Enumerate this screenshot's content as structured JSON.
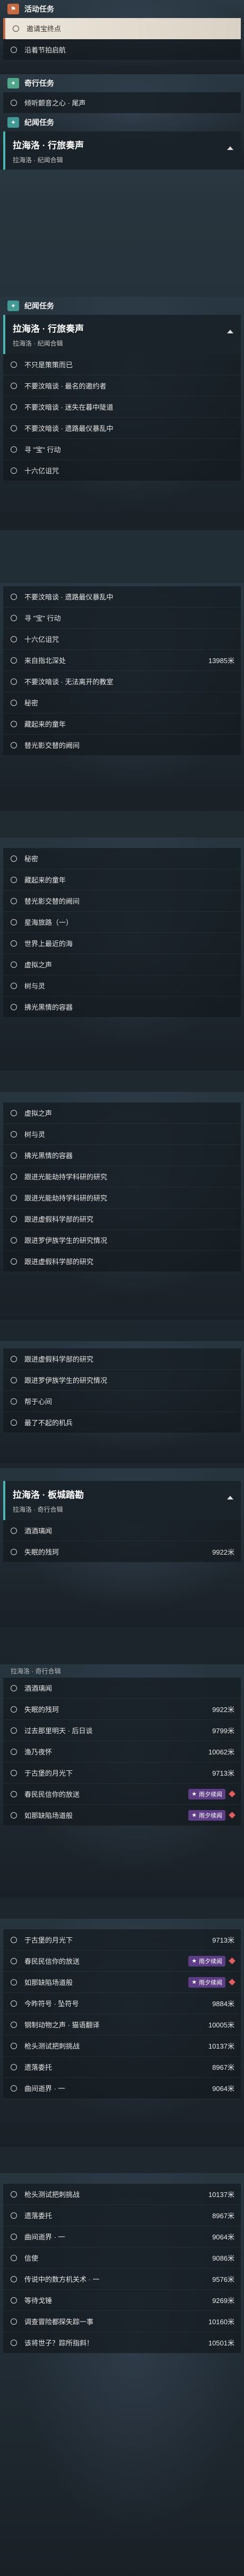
{
  "sections": {
    "event": "活动任务",
    "fortune": "奇行任务",
    "chronicle": "纪闻任务"
  },
  "event_tasks": [
    "邀请宝终点",
    "沿着节拍启航"
  ],
  "fortune_tasks": [
    "倾听颤音之心 · 尾声"
  ],
  "quest": {
    "title": "拉海洛 · 行旅奏声",
    "title_alt": "拉海洛 · 板城踏勘",
    "subtitle": "拉海洛 · 纪闻合辑",
    "subtitle_alt": "拉海洛 · 奇行合辑"
  },
  "list_a": [
    "不只是策策而已",
    "不要汶暗谈 · 最名的邀约者",
    "不要汶暗谈 · 迷失在暮中陡道",
    "不要汶暗谈 · 遗路最仪暴乱中",
    "寻 \"宝\" 行动",
    "十六亿诅咒"
  ],
  "list_b": [
    {
      "label": "不要汶暗谈 · 遗路最仪暴乱中",
      "dist": ""
    },
    {
      "label": "寻 \"宝\" 行动",
      "dist": ""
    },
    {
      "label": "十六亿诅咒",
      "dist": ""
    },
    {
      "label": "来自指北深处",
      "dist": "13985米"
    },
    {
      "label": "不要汶暗谈 · 无法离开的教室",
      "dist": ""
    },
    {
      "label": "秘密",
      "dist": ""
    },
    {
      "label": "藏起来的童年",
      "dist": ""
    },
    {
      "label": "替光影交替的阙间",
      "dist": ""
    }
  ],
  "list_c": [
    "秘密",
    "藏起来的童年",
    "替光影交替的阙间",
    "星海旅路（一）",
    "世界上最近的海",
    "虚拟之声",
    "树与灵",
    "拂光黑情的容器"
  ],
  "list_d": [
    "虚拟之声",
    "树与灵",
    "拂光黑情的容器",
    "跟进光能劫持学科研的研究",
    "跟进光能劫持学科研的研究",
    "跟进虚假科学部的研究",
    "跟进罗伊族学生的研究情况",
    "跟进虚假科学部的研究"
  ],
  "list_e": [
    "跟进虚假科学部的研究",
    "跟进罗伊族学生的研究情况",
    "帮于心间",
    "最了不起的机兵"
  ],
  "list_f": [
    {
      "label": "酒酒璃闻",
      "dist": ""
    },
    {
      "label": "失眠的残珂",
      "dist": "9922米"
    }
  ],
  "list_g": [
    {
      "label": "酒酒璃闻",
      "dist": "",
      "tag": ""
    },
    {
      "label": "失眠的残珂",
      "dist": "9922米",
      "tag": ""
    },
    {
      "label": "过去那里明天 · 后日谈",
      "dist": "9799米",
      "tag": ""
    },
    {
      "label": "渔乃夜怀",
      "dist": "10062米",
      "tag": ""
    },
    {
      "label": "于古堡的月光下",
      "dist": "9713米",
      "tag": ""
    },
    {
      "label": "春民民信你的放送",
      "dist": "",
      "tag": "雨夕续闻"
    },
    {
      "label": "如那缺陷场道般",
      "dist": "",
      "tag": "雨夕续闻"
    }
  ],
  "list_h": [
    {
      "label": "于古堡的月光下",
      "dist": "9713米",
      "tag": ""
    },
    {
      "label": "春民民信你的放送",
      "dist": "",
      "tag": "雨夕续闻"
    },
    {
      "label": "如那缺陷场道般",
      "dist": "",
      "tag": "雨夕续闻"
    },
    {
      "label": "今昨符号 · 坠符号",
      "dist": "9884米",
      "tag": ""
    },
    {
      "label": "钢制动物之声 · 猫语翻译",
      "dist": "10005米",
      "tag": ""
    },
    {
      "label": "枪头测试把刺挑战",
      "dist": "10137米",
      "tag": ""
    },
    {
      "label": "遗落委托",
      "dist": "8967米",
      "tag": ""
    },
    {
      "label": "曲间逝界 · 一",
      "dist": "9064米",
      "tag": ""
    }
  ],
  "list_i": [
    {
      "label": "枪头测试把刺挑战",
      "dist": "10137米"
    },
    {
      "label": "遗落委托",
      "dist": "8967米"
    },
    {
      "label": "曲间逝界 · 一",
      "dist": "9064米"
    },
    {
      "label": "信使",
      "dist": "9086米"
    },
    {
      "label": "传说中的数方机关术 · 一",
      "dist": "9576米"
    },
    {
      "label": "等待戈锤",
      "dist": "9269米"
    },
    {
      "label": "调查冒险都探失踪一事",
      "dist": "10160米"
    },
    {
      "label": "该将世子？踪所指斜！",
      "dist": "10501米"
    }
  ]
}
